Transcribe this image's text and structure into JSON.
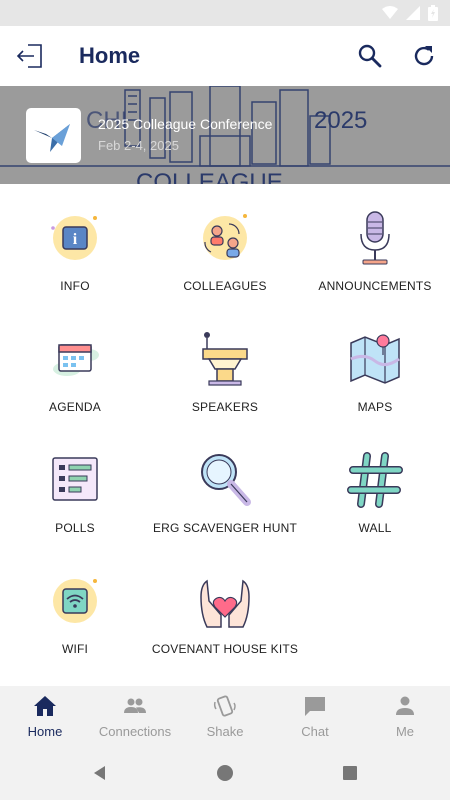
{
  "header": {
    "title": "Home"
  },
  "event": {
    "title": "2025 Colleague Conference",
    "dates": "Feb 2-4, 2025",
    "banner_text": "CHI",
    "banner_year": "2025",
    "banner_word": "COLLEAGUE"
  },
  "tiles": [
    {
      "label": "INFO",
      "icon": "info-icon"
    },
    {
      "label": "COLLEAGUES",
      "icon": "colleagues-icon"
    },
    {
      "label": "ANNOUNCEMENTS",
      "icon": "microphone-icon"
    },
    {
      "label": "AGENDA",
      "icon": "calendar-icon"
    },
    {
      "label": "SPEAKERS",
      "icon": "podium-icon"
    },
    {
      "label": "MAPS",
      "icon": "map-icon"
    },
    {
      "label": "POLLS",
      "icon": "poll-icon"
    },
    {
      "label": "ERG SCAVENGER HUNT",
      "icon": "magnifier-icon"
    },
    {
      "label": "WALL",
      "icon": "hashtag-icon"
    },
    {
      "label": "WIFI",
      "icon": "wifi-icon"
    },
    {
      "label": "COVENANT HOUSE KITS",
      "icon": "hands-heart-icon"
    }
  ],
  "bottom_nav": [
    {
      "label": "Home",
      "active": true
    },
    {
      "label": "Connections",
      "active": false
    },
    {
      "label": "Shake",
      "active": false
    },
    {
      "label": "Chat",
      "active": false
    },
    {
      "label": "Me",
      "active": false
    }
  ],
  "colors": {
    "primary": "#1a2a5e",
    "inactive": "#9a9a9a",
    "banner_overlay": "#9b9b9b"
  }
}
